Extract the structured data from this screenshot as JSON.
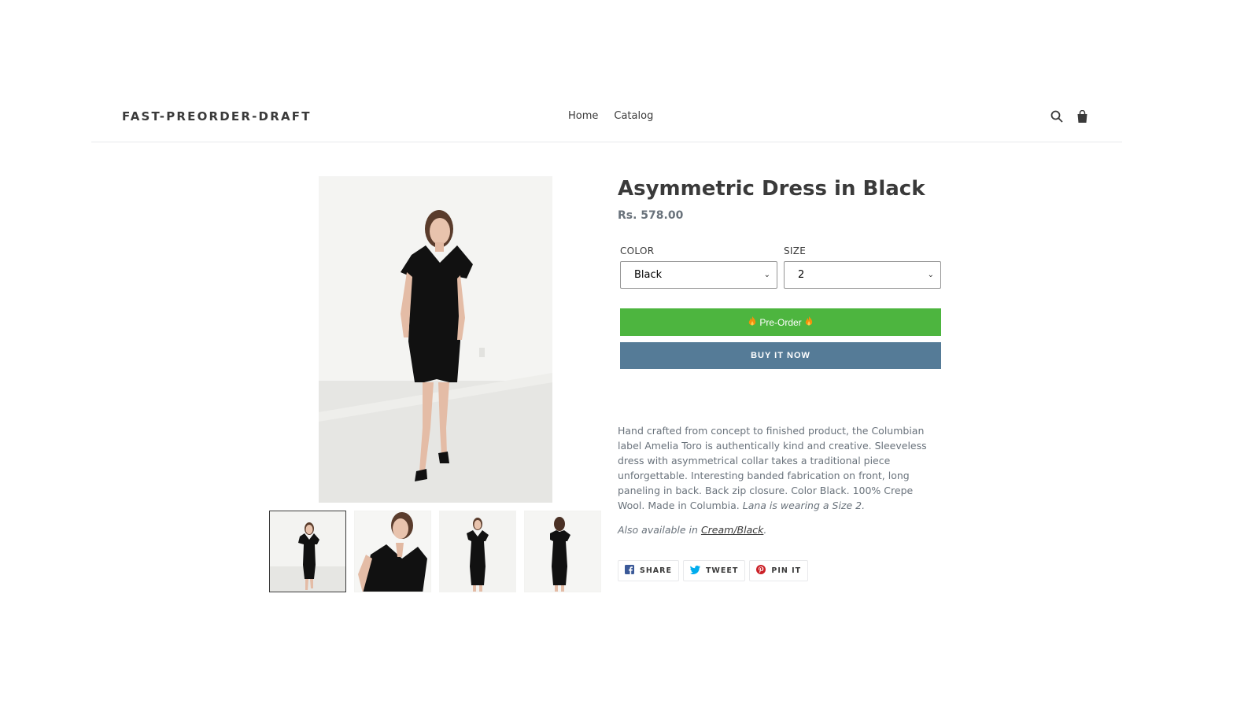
{
  "header": {
    "logo": "FAST-PREORDER-DRAFT",
    "nav": [
      {
        "label": "Home"
      },
      {
        "label": "Catalog"
      }
    ],
    "icons": [
      "search-icon",
      "cart-icon"
    ]
  },
  "product": {
    "title": "Asymmetric Dress in Black",
    "price": "Rs. 578.00",
    "options": {
      "color_label": "COLOR",
      "color_value": "Black",
      "size_label": "SIZE",
      "size_value": "2"
    },
    "preorder_label": "Pre-Order",
    "buy_now_label": "BUY IT NOW",
    "description": "Hand crafted from concept to finished product, the Columbian label Amelia Toro is authentically kind and creative. Sleeveless dress with asymmetrical collar takes a traditional piece unforgettable. Interesting banded fabrication on front, long paneling in back. Back zip closure. Color Black. 100% Crepe Wool. Made in Columbia.",
    "description_italic": "Lana is wearing a Size 2.",
    "also_prefix": "Also available in",
    "also_link": "Cream/Black",
    "also_suffix": ".",
    "share": [
      {
        "label": "SHARE",
        "icon": "facebook-icon",
        "color": "#3b5998"
      },
      {
        "label": "TWEET",
        "icon": "twitter-icon",
        "color": "#00aced"
      },
      {
        "label": "PIN IT",
        "icon": "pinterest-icon",
        "color": "#cb2027"
      }
    ]
  },
  "colors": {
    "preorder": "#4db53f",
    "buy_now": "#557b97",
    "text": "#3a3a3a",
    "muted": "#69727b"
  }
}
